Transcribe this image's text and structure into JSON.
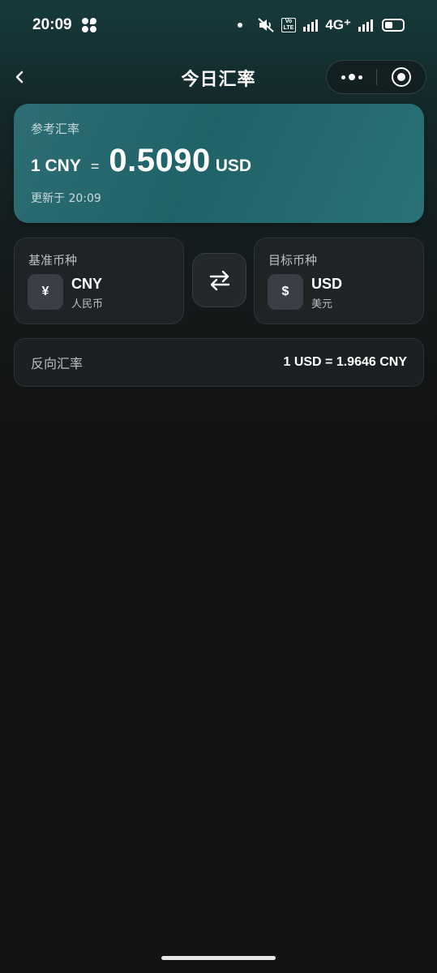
{
  "status_bar": {
    "time": "20:09",
    "volte_top": "Vo",
    "volte_bottom": "LTE",
    "sim_1": "1",
    "sim_2": "2",
    "network": "4G⁺"
  },
  "nav": {
    "title": "今日汇率",
    "back_icon": "chevron-left-icon",
    "more_icon": "more-dots-icon",
    "close_icon": "target-circle-icon"
  },
  "rate_card": {
    "label": "参考汇率",
    "base": "1 CNY",
    "equals": "=",
    "value": "0.5090",
    "target": "USD",
    "updated": "更新于 20:09"
  },
  "base_currency": {
    "label": "基准币种",
    "symbol": "¥",
    "code": "CNY",
    "name": "人民币"
  },
  "target_currency": {
    "label": "目标币种",
    "symbol": "$",
    "code": "USD",
    "name": "美元"
  },
  "swap_icon": "swap-arrows-icon",
  "inverse": {
    "label": "反向汇率",
    "value": "1 USD = 1.9646 CNY"
  },
  "colors": {
    "background": "#131313",
    "rate_card": "#1f6368",
    "card": "#1e2326"
  }
}
